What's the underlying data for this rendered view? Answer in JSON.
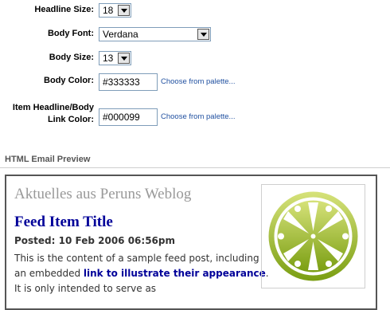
{
  "form": {
    "headline_size": {
      "label": "Headline Size:",
      "value": "18"
    },
    "body_font": {
      "label": "Body Font:",
      "value": "Verdana"
    },
    "body_size": {
      "label": "Body Size:",
      "value": "13"
    },
    "body_color": {
      "label": "Body Color:",
      "value": "#333333",
      "palette_link": "Choose from palette..."
    },
    "link_color": {
      "label_line1": "Item Headline/Body",
      "label_line2": "Link Color:",
      "value": "#000099",
      "palette_link": "Choose from palette..."
    }
  },
  "preview": {
    "section_title": "HTML Email Preview",
    "blog_title": "Aktuelles aus Peruns Weblog",
    "item_title": "Feed Item Title",
    "posted": "Posted: 10 Feb 2006 06:56pm",
    "body_before": "This is the content of a sample feed post, including an embedded ",
    "body_link": "link to illustrate their appearance",
    "body_after": ". It is only intended to serve as",
    "logo_icon": "weblog-logo-icon",
    "colors": {
      "body": "#333333",
      "link": "#000099",
      "logo_green": "#8aad1e"
    }
  }
}
